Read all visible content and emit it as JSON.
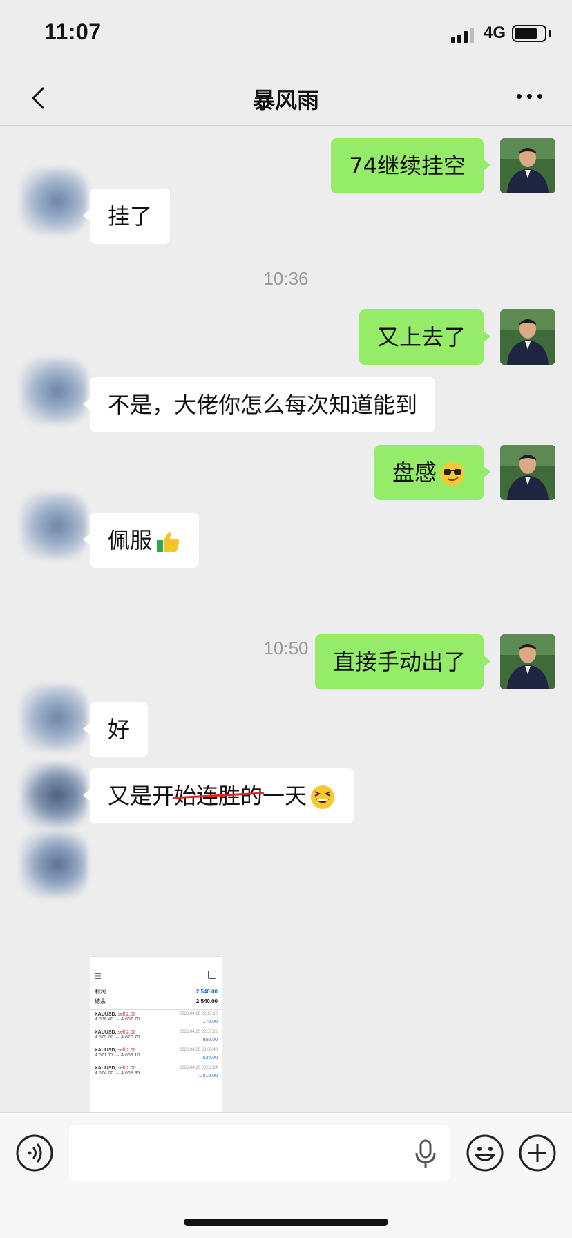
{
  "status": {
    "time": "11:07",
    "network": "4G"
  },
  "nav": {
    "title": "暴风雨"
  },
  "messages": {
    "m1": "74继续挂空",
    "m2": "挂了",
    "t1": "10:36",
    "m3": "又上去了",
    "m4": "不是，大佬你怎么每次知道能到",
    "m5": "盘感",
    "m6": "佩服",
    "t2": "10:50",
    "m7": "直接手动出了",
    "m8": "好",
    "m9_a": "又是开",
    "m9_b": "始连胜的",
    "m9_c": "一天"
  },
  "emojis": {
    "m5": "sunglasses-face",
    "m6": "thumbs-up",
    "m9": "grinning-squinting-face"
  },
  "thumbnail": {
    "summary": [
      {
        "label": "利润",
        "value": "2 540.00"
      },
      {
        "label": "结余",
        "value": "2 540.00"
      }
    ],
    "trades": [
      {
        "symbol": "XAUUSD,",
        "side": "sell 2.00",
        "prices": "4 668.45 → 4 667.70",
        "date": "2026.04.20 22:17:10",
        "profit": "170.00"
      },
      {
        "symbol": "XAUUSD,",
        "side": "sell 2.00",
        "prices": "4 675.00 → 4 670.75",
        "date": "2026.04.20 22:37:22",
        "profit": "850.00"
      },
      {
        "symbol": "XAUUSD,",
        "side": "sell 2.00",
        "prices": "4 671.77 → 4 669.10",
        "date": "2026.04.20 23:38:48",
        "profit": "534.00"
      },
      {
        "symbol": "XAUUSD,",
        "side": "sell 2.00",
        "prices": "4 674.00 → 4 668.95",
        "date": "2026.04.20 23:52:24",
        "profit": "1 010.00"
      }
    ]
  },
  "input": {
    "placeholder": ""
  },
  "colors": {
    "bubble_me": "#95ec69",
    "bubble_other": "#ffffff",
    "background": "#ededed"
  }
}
